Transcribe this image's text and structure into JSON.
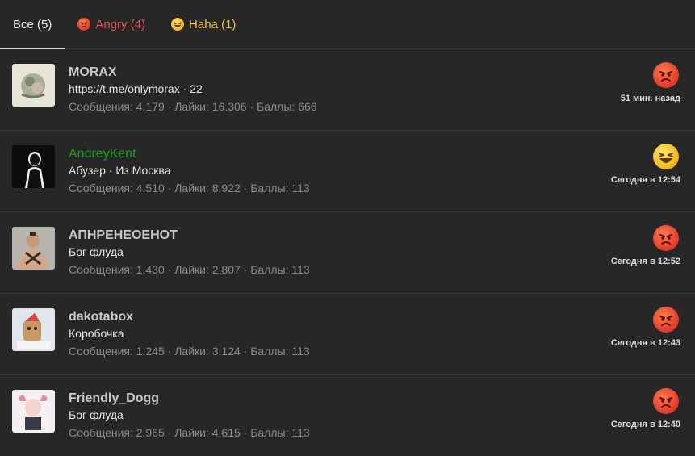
{
  "tabs": [
    {
      "label": "Все (5)",
      "icon": "",
      "active": true
    },
    {
      "label": "Angry (4)",
      "icon": "angry-emoji-icon"
    },
    {
      "label": "Haha (1)",
      "icon": "haha-emoji-icon"
    }
  ],
  "colors": {
    "background": "#272727",
    "angry": "#e35454",
    "haha": "#f0c13d",
    "green_user": "#1f9a1f"
  },
  "reactions": [
    {
      "username": "MORAX",
      "title": "https://t.me/onlymorax · 22",
      "stats": "Сообщения: 4.179 · Лайки: 16.306 · Баллы: 666",
      "reaction": "angry",
      "time": "51 мин. назад"
    },
    {
      "username": "AndreyKent",
      "title": "Абузер · Из Москва",
      "stats": "Сообщения: 4.510 · Лайки: 8.922 · Баллы: 113",
      "reaction": "haha",
      "time": "Сегодня в 12:54"
    },
    {
      "username": "АПНРЕНЕОЕНОТ",
      "title": "Бог флуда",
      "stats": "Сообщения: 1.430 · Лайки: 2.807 · Баллы: 113",
      "reaction": "angry",
      "time": "Сегодня в 12:52"
    },
    {
      "username": "dakotabox",
      "title": "Коробочка",
      "stats": "Сообщения: 1.245 · Лайки: 3.124 · Баллы: 113",
      "reaction": "angry",
      "time": "Сегодня в 12:43"
    },
    {
      "username": "Friendly_Dogg",
      "title": "Бог флуда",
      "stats": "Сообщения: 2.965 · Лайки: 4.615 · Баллы: 113",
      "reaction": "angry",
      "time": "Сегодня в 12:40"
    }
  ]
}
